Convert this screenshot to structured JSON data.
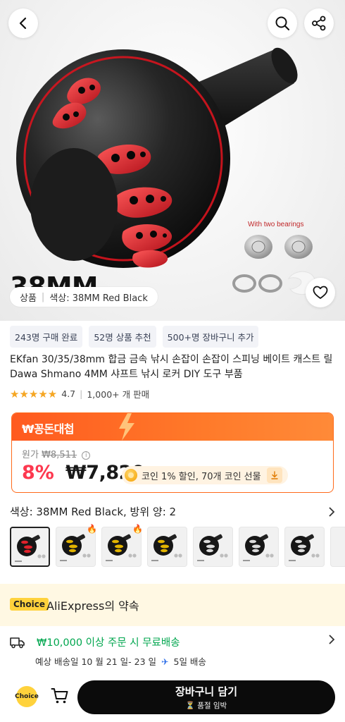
{
  "hero": {
    "size_overlay": "38MM",
    "bearing_caption": "With two bearings",
    "variant_pill": {
      "prefix": "상품",
      "label": "색상: 38MM Red Black"
    }
  },
  "tags": [
    "243명 구매 완료",
    "52명 상품 추천",
    "500+명 장바구니 추가"
  ],
  "product_title": "EKfan 30/35/38mm 합금 금속 낚시 손잡이 손잡이 스피닝 베이트 캐스트 릴 Dawa Shmano 4MM 샤프트 낚시 로커 DIY 도구 부품",
  "rating": {
    "stars": "★★★★★",
    "score": "4.7",
    "sold": "1,000+ 개 판매"
  },
  "price_card": {
    "header": "₩꽁돈대첩",
    "original_label": "원가",
    "original_price": "₩8,511",
    "discount": "8%",
    "price": "₩7,820",
    "coin_text": "코인 1% 할인, 70개 코인 선물"
  },
  "color_row": {
    "label": "색상: 38MM Red Black, 방위 양: 2"
  },
  "thumbs": [
    {
      "name": "38MM Red Black",
      "accent": "#e0222b",
      "selected": true,
      "hot": false
    },
    {
      "name": "Gold",
      "accent": "#e2b400",
      "selected": false,
      "hot": true
    },
    {
      "name": "Gold",
      "accent": "#e2b400",
      "selected": false,
      "hot": true
    },
    {
      "name": "Gold",
      "accent": "#e2b400",
      "selected": false,
      "hot": false
    },
    {
      "name": "Silver",
      "accent": "#dcdcdc",
      "selected": false,
      "hot": false
    },
    {
      "name": "Silver",
      "accent": "#dcdcdc",
      "selected": false,
      "hot": false
    },
    {
      "name": "Silver",
      "accent": "#dcdcdc",
      "selected": false,
      "hot": false
    }
  ],
  "choice": {
    "badge": "Choice",
    "title": "AliExpress의 약속"
  },
  "shipping": {
    "main": "₩10,000 이상 주문 시 무료배송",
    "sub_prefix": "예상 배송일 10 월 21 일- 23 일",
    "sub_suffix": "5일 배송"
  },
  "bottom": {
    "choice_badge": "Choice",
    "cart_button": "장바구니 담기",
    "cart_sub": "⏳ 품절 임박"
  },
  "colors": {
    "accent_orange": "#ff6a1a",
    "discount_red": "#fd384f",
    "ship_green": "#00a64e",
    "choice_yellow": "#ffd23c"
  }
}
